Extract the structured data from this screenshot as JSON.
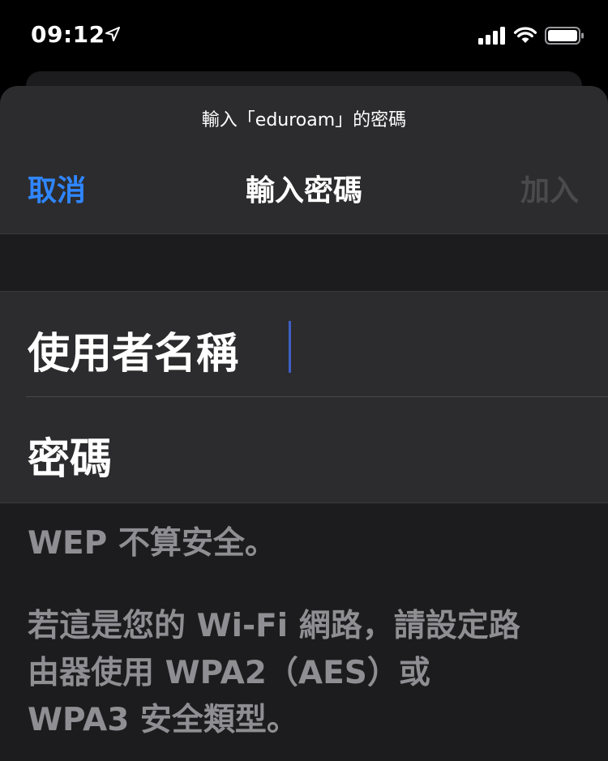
{
  "status_bar": {
    "time": "09:12",
    "icons": [
      "location-arrow-icon",
      "cellular-signal-icon",
      "wifi-icon",
      "battery-icon"
    ]
  },
  "sheet": {
    "prompt": "輸入「eduroam」的密碼",
    "nav": {
      "cancel_label": "取消",
      "title": "輸入密碼",
      "join_label": "加入"
    },
    "fields": {
      "username_label": "使用者名稱",
      "username_value": "",
      "password_label": "密碼",
      "password_value": ""
    },
    "footer": {
      "warning": "WEP 不算安全。",
      "advice_line1": "若這是您的 Wi-Fi 網路，請設定路",
      "advice_line2": "由器使用 WPA2（AES）或",
      "advice_line3": "WPA3 安全類型。"
    }
  },
  "colors": {
    "accent": "#2f86ff",
    "disabled": "#4a4a4d",
    "cursor": "#3e5fc4",
    "footer_text": "#8e8e93"
  }
}
